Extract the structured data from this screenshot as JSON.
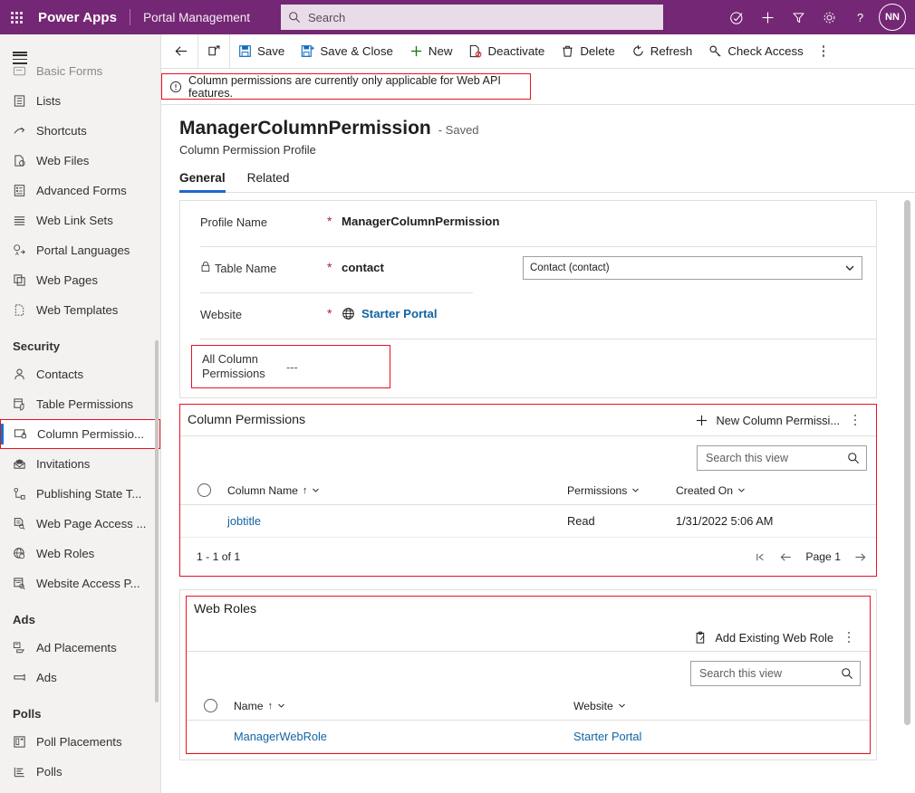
{
  "topbar": {
    "waffle_title": "App launcher",
    "brand": "Power Apps",
    "app_name": "Portal Management",
    "search_placeholder": "Search",
    "icons": [
      "pen-check-icon",
      "plus-icon",
      "filter-icon",
      "gear-icon",
      "help-icon"
    ],
    "avatar_initials": "NN",
    "accent_color": "#742774"
  },
  "commandbar": {
    "back_label": "Back",
    "popout_label": "Open in new window",
    "buttons": [
      {
        "label": "Save",
        "icon": "save-icon"
      },
      {
        "label": "Save & Close",
        "icon": "save-close-icon"
      },
      {
        "label": "New",
        "icon": "plus-icon"
      },
      {
        "label": "Deactivate",
        "icon": "deactivate-icon"
      },
      {
        "label": "Delete",
        "icon": "trash-icon"
      },
      {
        "label": "Refresh",
        "icon": "refresh-icon"
      },
      {
        "label": "Check Access",
        "icon": "key-icon"
      }
    ],
    "overflow_label": "More commands"
  },
  "notification": {
    "text": "Column permissions are currently only applicable for Web API features.",
    "icon": "info-icon",
    "border_color": "#e81123"
  },
  "sidebar": {
    "hamburger_label": "Expand navigation",
    "items": [
      {
        "label": "Basic Forms",
        "icon": "basic-forms-icon",
        "group": null,
        "selected": false,
        "clipped": true
      },
      {
        "label": "Lists",
        "icon": "lists-icon",
        "group": null,
        "selected": false
      },
      {
        "label": "Shortcuts",
        "icon": "shortcuts-icon",
        "group": null,
        "selected": false
      },
      {
        "label": "Web Files",
        "icon": "web-files-icon",
        "group": null,
        "selected": false
      },
      {
        "label": "Advanced Forms",
        "icon": "advanced-forms-icon",
        "group": null,
        "selected": false
      },
      {
        "label": "Web Link Sets",
        "icon": "web-link-sets-icon",
        "group": null,
        "selected": false
      },
      {
        "label": "Portal Languages",
        "icon": "portal-languages-icon",
        "group": null,
        "selected": false
      },
      {
        "label": "Web Pages",
        "icon": "web-pages-icon",
        "group": null,
        "selected": false
      },
      {
        "label": "Web Templates",
        "icon": "web-templates-icon",
        "group": null,
        "selected": false
      }
    ],
    "groups": [
      {
        "title": "Security",
        "items": [
          {
            "label": "Contacts",
            "icon": "contacts-icon",
            "selected": false
          },
          {
            "label": "Table Permissions",
            "icon": "table-permissions-icon",
            "selected": false
          },
          {
            "label": "Column Permissio...",
            "icon": "column-permissions-icon",
            "selected": true
          },
          {
            "label": "Invitations",
            "icon": "invitations-icon",
            "selected": false
          },
          {
            "label": "Publishing State T...",
            "icon": "publishing-state-icon",
            "selected": false
          },
          {
            "label": "Web Page Access ...",
            "icon": "web-page-access-icon",
            "selected": false
          },
          {
            "label": "Web Roles",
            "icon": "web-roles-icon",
            "selected": false
          },
          {
            "label": "Website Access P...",
            "icon": "website-access-icon",
            "selected": false
          }
        ]
      },
      {
        "title": "Ads",
        "items": [
          {
            "label": "Ad Placements",
            "icon": "ad-placements-icon",
            "selected": false
          },
          {
            "label": "Ads",
            "icon": "ads-icon",
            "selected": false
          }
        ]
      },
      {
        "title": "Polls",
        "items": [
          {
            "label": "Poll Placements",
            "icon": "poll-placements-icon",
            "selected": false
          },
          {
            "label": "Polls",
            "icon": "polls-icon",
            "selected": false
          }
        ]
      }
    ]
  },
  "record": {
    "title": "ManagerColumnPermission",
    "save_state": "- Saved",
    "subtitle": "Column Permission Profile",
    "tabs": [
      {
        "label": "General",
        "active": true
      },
      {
        "label": "Related",
        "active": false
      }
    ]
  },
  "form": {
    "fields": [
      {
        "label": "Profile Name",
        "required": "*",
        "value": "ManagerColumnPermission",
        "type": "text"
      },
      {
        "label": "Table Name",
        "required": "*",
        "value": "contact",
        "type": "locked-text",
        "icon": "lock-icon"
      },
      {
        "label": "Website",
        "required": "*",
        "value": "Starter Portal",
        "type": "lookup",
        "icon": "globe-icon"
      }
    ],
    "table_combo_value": "Contact (contact)",
    "all_column_permissions": {
      "label_line1": "All Column",
      "label_line2": "Permissions",
      "value": "---",
      "highlight_color": "#e81123"
    }
  },
  "column_permissions_grid": {
    "title": "Column Permissions",
    "new_button_label": "New Column Permissi...",
    "new_button_icon": "plus-icon",
    "overflow_label": "More commands",
    "search_placeholder": "Search this view",
    "search_icon": "search-icon",
    "select_all_label": "Select all rows",
    "columns": [
      {
        "label": "Column Name",
        "sorted": "asc"
      },
      {
        "label": "Permissions",
        "sorted": null
      },
      {
        "label": "Created On",
        "sorted": null
      }
    ],
    "rows": [
      {
        "name": "jobtitle",
        "permissions": "Read",
        "created_on": "1/31/2022 5:06 AM"
      }
    ],
    "footer_count": "1 - 1 of 1",
    "page_label": "Page 1",
    "highlight_color": "#e81123"
  },
  "web_roles_grid": {
    "title": "Web Roles",
    "add_button_label": "Add Existing Web Role",
    "add_button_icon": "add-existing-icon",
    "overflow_label": "More commands",
    "search_placeholder": "Search this view",
    "search_icon": "search-icon",
    "select_all_label": "Select all rows",
    "columns": [
      {
        "label": "Name",
        "sorted": "asc"
      },
      {
        "label": "Website",
        "sorted": null
      }
    ],
    "rows": [
      {
        "name": "ManagerWebRole",
        "website": "Starter Portal"
      }
    ],
    "highlight_color": "#e81123"
  }
}
